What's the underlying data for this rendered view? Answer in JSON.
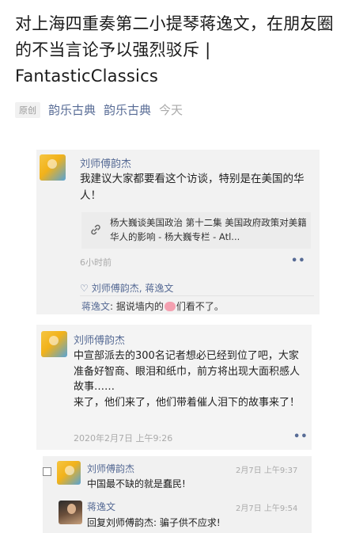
{
  "article": {
    "title": "对上海四重奏第二小提琴蒋逸文，在朋友圈的不当言论予以强烈驳斥 | FantasticClassics",
    "meta_tag": "原创",
    "meta_account": "韵乐古典",
    "meta_author": "韵乐古典",
    "meta_time": "今天"
  },
  "post1": {
    "author": "刘师傅韵杰",
    "text": "我建议大家都要看这个访谈，特别是在美国的华人！",
    "link_icon": "link-icon",
    "link_text": "杨大巍谈美国政治 第十二集 美国政府政策对美籍华人的影响 - 杨大巍专栏 - Atl...",
    "time": "6小时前",
    "more": "••",
    "likes": "刘师傅韵杰, 蒋逸文",
    "reply_name": "蒋逸文",
    "reply_before": ": 据说墙内的",
    "reply_after": "们看不了。"
  },
  "post2": {
    "author": "刘师傅韵杰",
    "text": "中宣部派去的300名记者想必已经到位了吧，大家准备好智商、眼泪和纸巾，前方将出现大面积感人故事……\n来了，他们来了，他们带着催人泪下的故事来了！",
    "time": "2020年2月7日 上午9:26",
    "more": "••"
  },
  "comments": [
    {
      "author": "刘师傅韵杰",
      "text": "中国最不缺的就是蠢民!",
      "time": "2月7日 上午9:37"
    },
    {
      "author": "蒋逸文",
      "text": "回复刘师傅韵杰: 骗子供不应求!",
      "time": "2月7日 上午9:54"
    }
  ]
}
